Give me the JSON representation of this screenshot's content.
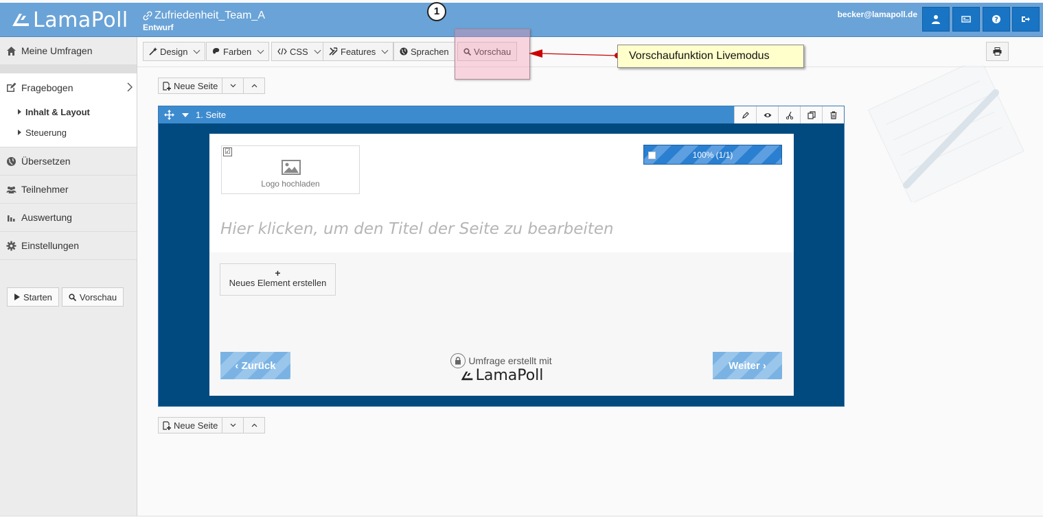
{
  "header": {
    "logo_text": "LamaPoll",
    "survey_title": "Zufriedenheit_Team_A",
    "survey_status": "Entwurf",
    "user_email": "becker@lamapoll.de"
  },
  "callout": {
    "number": "1",
    "annotation": "Vorschaufunktion Livemodus"
  },
  "sidebar": {
    "items": [
      {
        "label": "Meine Umfragen"
      },
      {
        "label": "Fragebogen"
      },
      {
        "label": "Übersetzen"
      },
      {
        "label": "Teilnehmer"
      },
      {
        "label": "Auswertung"
      },
      {
        "label": "Einstellungen"
      }
    ],
    "sub_items": [
      {
        "label": "Inhalt & Layout"
      },
      {
        "label": "Steuerung"
      }
    ],
    "start_label": "Starten",
    "preview_label": "Vorschau"
  },
  "toolbar": {
    "design": "Design",
    "colors": "Farben",
    "css": "CSS",
    "features": "Features",
    "languages": "Sprachen",
    "preview": "Vorschau"
  },
  "page_controls": {
    "new_page": "Neue Seite"
  },
  "page": {
    "name": "1. Seite",
    "logo_upload": "Logo hochladen",
    "logo_checkbox": "☑",
    "progress": "100% (1/1)",
    "title_placeholder": "Hier klicken, um den Titel der Seite zu bearbeiten",
    "new_element_plus": "+",
    "new_element": "Neues Element erstellen",
    "back": "‹ Zurück",
    "next": "Weiter ›",
    "created_with": "Umfrage erstellt mit",
    "brand": "LamaPoll"
  },
  "colors": {
    "header_bg": "#6aa3d7",
    "header_btn": "#1a74c4",
    "page_bg": "#004a80",
    "page_header": "#3d8bcf",
    "annotation_bg": "#ffffcc",
    "arrow": "#cc0000"
  }
}
